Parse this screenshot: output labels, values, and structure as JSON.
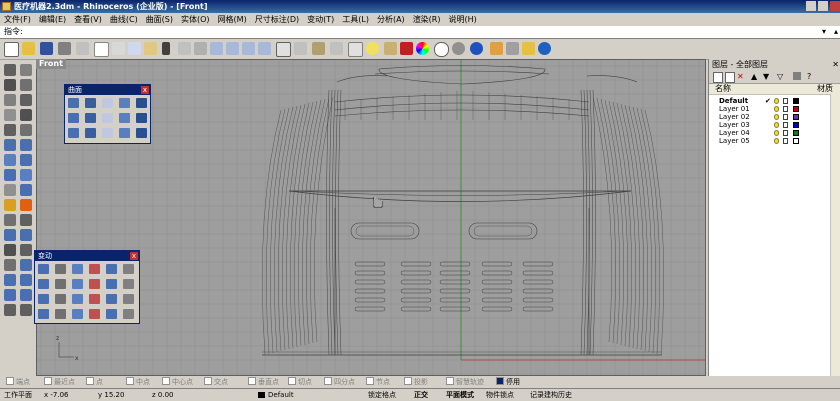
{
  "window": {
    "title": "医疗机器2.3dm - Rhinoceros (企业版) - [Front]"
  },
  "menu": [
    "文件(F)",
    "编辑(E)",
    "查看(V)",
    "曲线(C)",
    "曲面(S)",
    "实体(O)",
    "网格(M)",
    "尺寸标注(D)",
    "变动(T)",
    "工具(L)",
    "分析(A)",
    "渲染(R)",
    "说明(H)"
  ],
  "command": {
    "label": "指令:",
    "value": ""
  },
  "viewport": {
    "name": "Front",
    "axis_x": "x",
    "axis_z": "z"
  },
  "panels": {
    "surface": {
      "title": "曲面",
      "close": "x"
    },
    "transform": {
      "title": "变动",
      "close": "x"
    }
  },
  "layers_panel": {
    "title": "图层 - 全部图层",
    "col_name": "名称",
    "col_material": "材质",
    "current_mark": "✔",
    "layers": [
      {
        "name": "Default",
        "color": "#000000",
        "current": true
      },
      {
        "name": "Layer 01",
        "color": "#c00000"
      },
      {
        "name": "Layer 02",
        "color": "#7030a0"
      },
      {
        "name": "Layer 03",
        "color": "#0000c0"
      },
      {
        "name": "Layer 04",
        "color": "#008000"
      },
      {
        "name": "Layer 05",
        "color": "#ffffff"
      }
    ]
  },
  "osnap": {
    "items": [
      "端点",
      "最近点",
      "点",
      "中点",
      "中心点",
      "交点",
      "垂直点",
      "切点",
      "四分点",
      "节点",
      "投影",
      "智慧轨迹"
    ],
    "disable_label": "停用"
  },
  "status": {
    "cplane": "工作平面",
    "x": "x -7.06",
    "y": "y 15.20",
    "z": "z 0.00",
    "layer": "Default",
    "grid_snap": "锁定格点",
    "ortho": "正交",
    "planar": "平面模式",
    "osnap": "物件锁点",
    "history": "记录建构历史"
  },
  "colors": {
    "titlebar": "#0a246a",
    "viewport_bg": "#9e9e9e",
    "wireframe": "#404040",
    "axis_green": "#2e8b2e",
    "axis_red": "#b03030"
  }
}
